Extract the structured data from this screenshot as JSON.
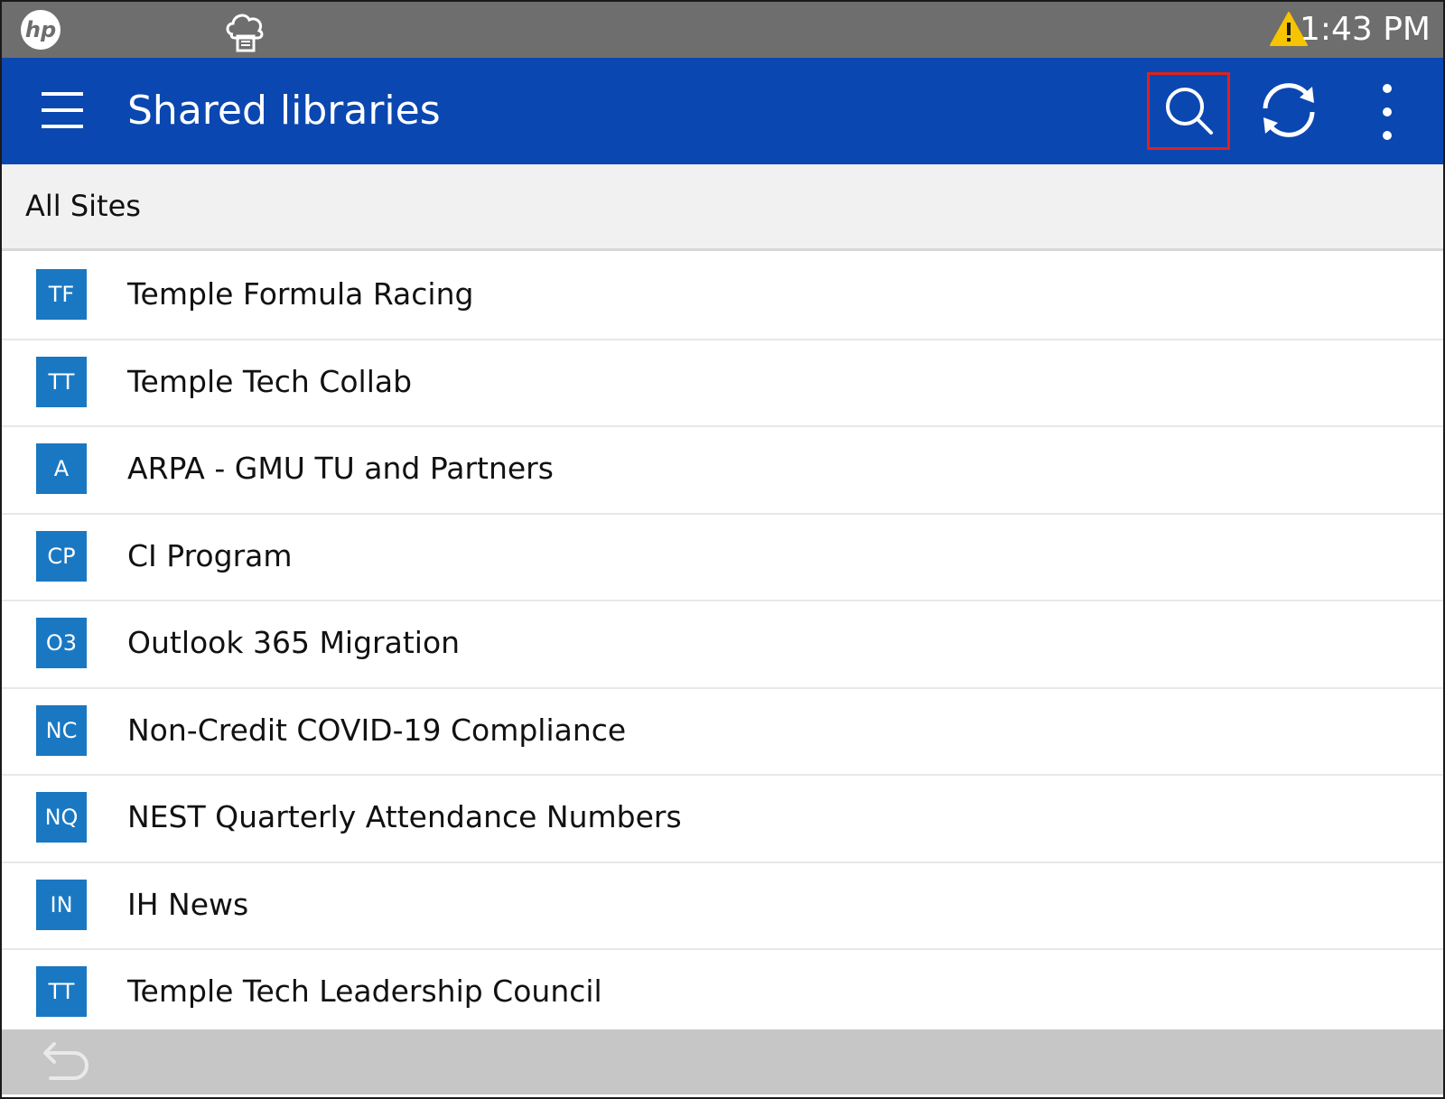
{
  "status_bar": {
    "time": "1:43 PM",
    "logo_icon": "hp-logo-icon",
    "cloud_icon": "cloud-lock-icon",
    "warning_icon": "warning-icon",
    "warning_color": "#f6c400"
  },
  "header": {
    "title": "Shared libraries",
    "menu_icon": "hamburger-menu-icon",
    "search_icon": "search-icon",
    "refresh_icon": "refresh-icon",
    "more_icon": "more-vertical-icon",
    "background_color": "#0b47b1",
    "highlight_color": "#e0221c"
  },
  "section": {
    "title": "All Sites"
  },
  "sites": [
    {
      "initials": "TF",
      "name": "Temple Formula Racing"
    },
    {
      "initials": "TT",
      "name": "Temple Tech Collab"
    },
    {
      "initials": "A",
      "name": "ARPA - GMU TU and Partners"
    },
    {
      "initials": "CP",
      "name": "CI Program"
    },
    {
      "initials": "O3",
      "name": "Outlook 365 Migration"
    },
    {
      "initials": "NC",
      "name": "Non-Credit COVID-19 Compliance"
    },
    {
      "initials": "NQ",
      "name": "NEST Quarterly Attendance Numbers"
    },
    {
      "initials": "IN",
      "name": "IH News"
    },
    {
      "initials": "TT",
      "name": "Temple Tech Leadership Council"
    }
  ],
  "badge_color": "#1a78c2",
  "bottom_bar": {
    "back_icon": "back-arrow-icon"
  }
}
